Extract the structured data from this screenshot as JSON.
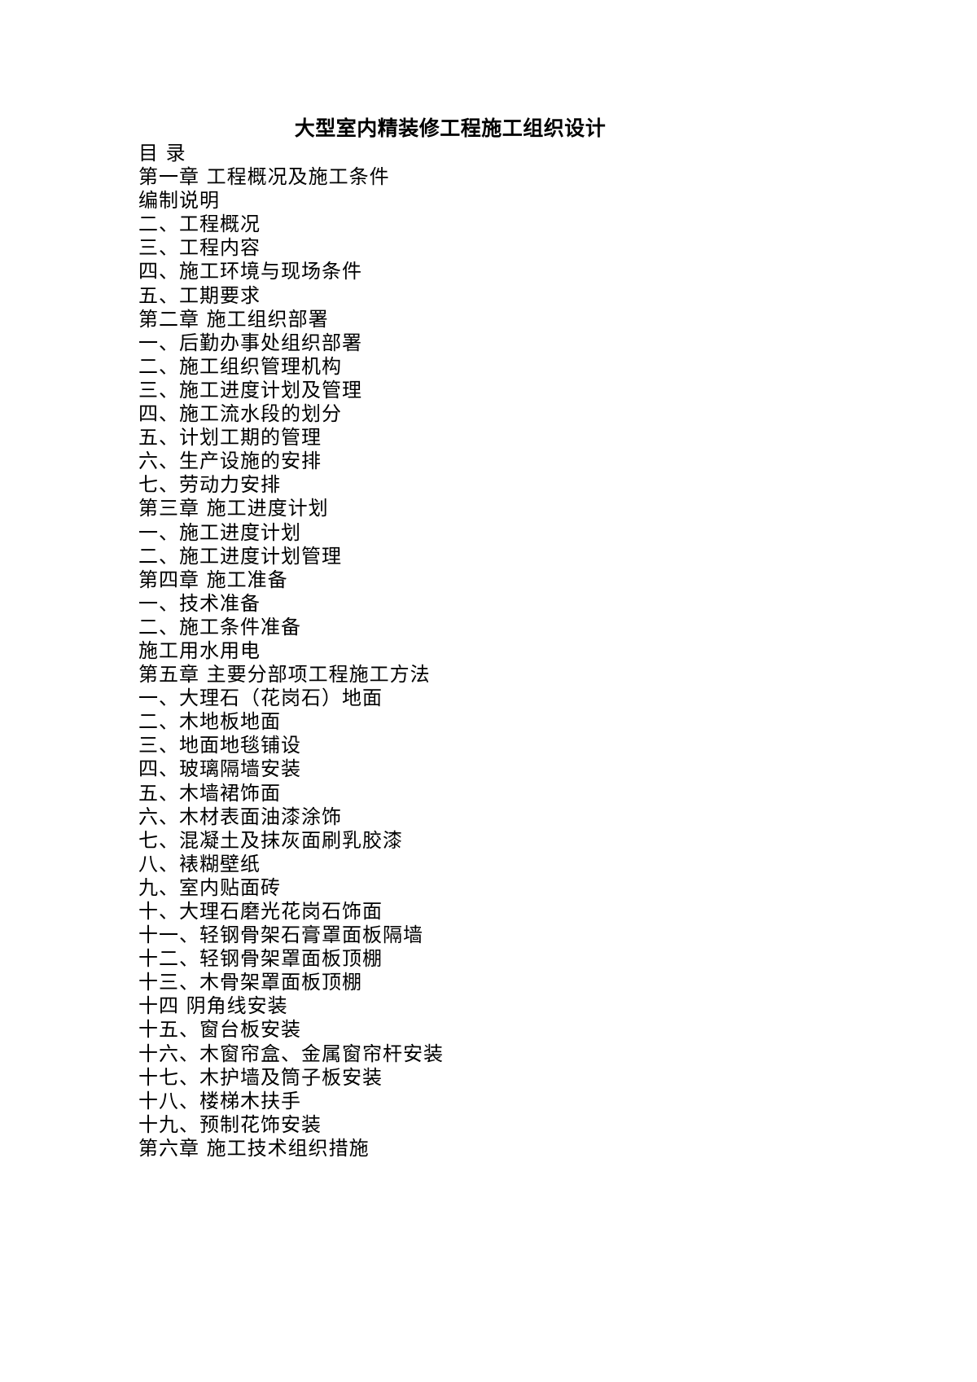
{
  "document": {
    "title": "大型室内精装修工程施工组织设计",
    "toc_heading": "目 录",
    "toc_lines": [
      "第一章 工程概况及施工条件",
      "编制说明",
      "二、工程概况",
      "三、工程内容",
      "四、施工环境与现场条件",
      "五、工期要求",
      "第二章 施工组织部署",
      "一、后勤办事处组织部署",
      "二、施工组织管理机构",
      "三、施工进度计划及管理",
      "四、施工流水段的划分",
      "五、计划工期的管理",
      "六、生产设施的安排",
      "七、劳动力安排",
      "第三章 施工进度计划",
      "一、施工进度计划",
      "二、施工进度计划管理",
      "第四章 施工准备",
      "一、技术准备",
      "二、施工条件准备",
      "施工用水用电",
      "第五章 主要分部项工程施工方法",
      "一、大理石（花岗石）地面",
      "二、木地板地面",
      "三、地面地毯铺设",
      "四、玻璃隔墙安装",
      "五、木墙裙饰面",
      "六、木材表面油漆涂饰",
      "七、混凝土及抹灰面刷乳胶漆",
      "八、裱糊壁纸",
      "九、室内贴面砖",
      "十、大理石磨光花岗石饰面",
      "十一、轻钢骨架石膏罩面板隔墙",
      "十二、轻钢骨架罩面板顶棚",
      "十三、木骨架罩面板顶棚",
      "十四 阴角线安装",
      "十五、窗台板安装",
      "十六、木窗帘盒、金属窗帘杆安装",
      "十七、木护墙及筒子板安装",
      "十八、楼梯木扶手",
      "十九、预制花饰安装",
      "第六章 施工技术组织措施"
    ]
  }
}
